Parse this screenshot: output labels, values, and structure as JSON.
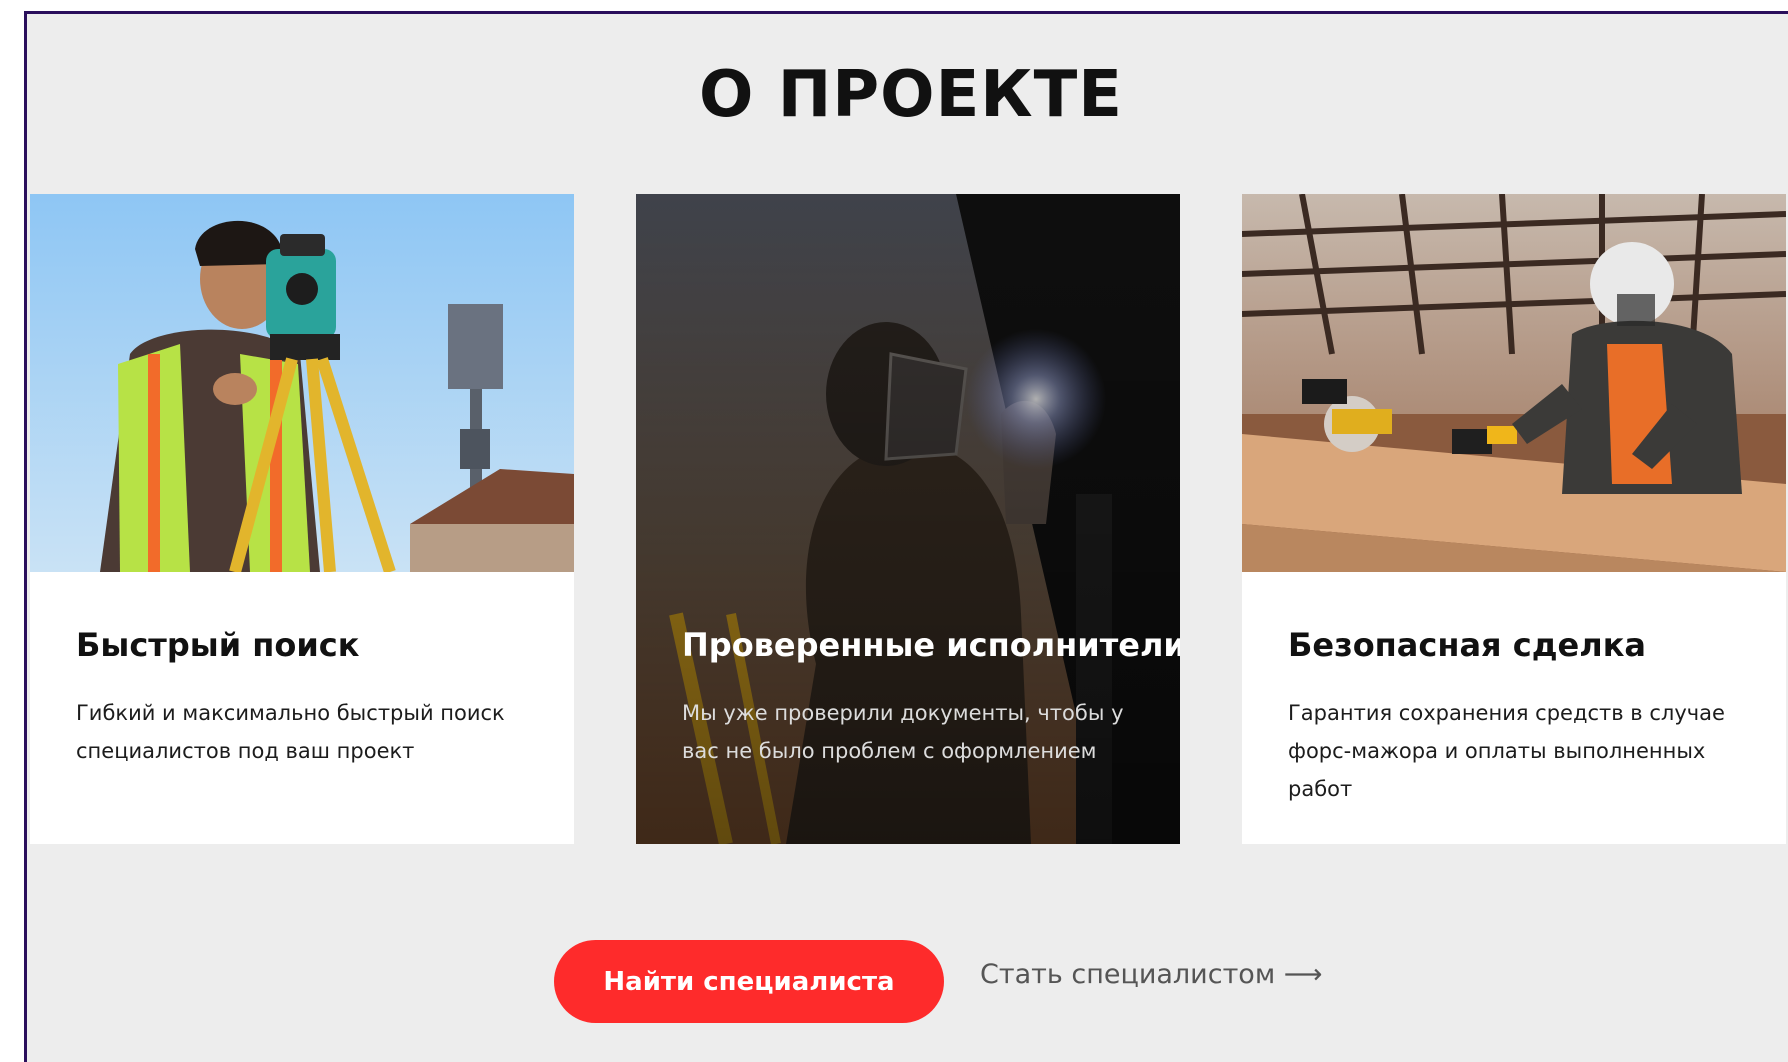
{
  "section": {
    "title": "О ПРОЕКТЕ"
  },
  "cards": [
    {
      "title": "Быстрый поиск",
      "text": "Гибкий и максимально быстрый поиск специалистов под ваш проект",
      "image": "surveyor-with-theodolite-photo"
    },
    {
      "title": "Проверенные исполнители",
      "text": "Мы уже проверили документы, чтобы у вас не было проблем с оформлением",
      "image": "welder-at-work-photo"
    },
    {
      "title": "Безопасная сделка",
      "text": "Гарантия сохранения средств в случае форс-мажора и оплаты выполненных работ",
      "image": "carpenter-at-workbench-photo"
    }
  ],
  "actions": {
    "primary_label": "Найти специалиста",
    "secondary_label": "Стать специалистом ⟶"
  },
  "colors": {
    "accent": "#fe2b2b",
    "background": "#ededed",
    "frame": "#2a0f5c"
  }
}
